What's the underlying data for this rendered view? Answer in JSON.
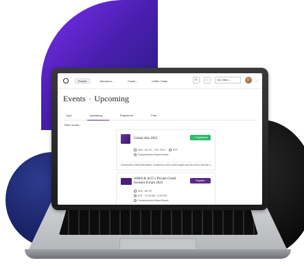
{
  "nav": {
    "items": [
      {
        "label": "Events",
        "active": true
      },
      {
        "label": "Allocators",
        "active": false
      },
      {
        "label": "Funds",
        "active": false
      },
      {
        "label": "Coffee Chats",
        "active": false
      }
    ],
    "allocators_caret": "⌄",
    "funds_caret": "⌄",
    "office_label": "My Office",
    "office_caret": "⌄",
    "avatar_caret": "⌄"
  },
  "header": {
    "crumb_1": "Events",
    "separator": "›",
    "crumb_2": "Upcoming"
  },
  "tabs": [
    {
      "label": "Type",
      "active": false
    },
    {
      "label": "Upcoming",
      "active": true
    },
    {
      "label": "Registered",
      "active": false
    },
    {
      "label": "Past",
      "active": false
    }
  ],
  "filter": {
    "label": "Filter results"
  },
  "events": [
    {
      "title": "Global Alts 2023",
      "status": "✓ Registered",
      "date": "Mon, Jan 30 – Thu, Feb 2",
      "tz": "EST",
      "location": "Fontainebleau Miami Beach",
      "description": "iConnections Global Alternatives Conference is the world's largest cap intro event. Become a..."
    },
    {
      "title": "AIMA & ACC's Private Credit Investor Forum 2023",
      "status": "Register",
      "date": "Mon, Jan 30",
      "time": "EST · 11:00 AM – 6:30 PM",
      "location": "Fontainebleau Miami Beach"
    }
  ],
  "colors": {
    "accent": "#5b2a86",
    "success": "#2fb96a"
  }
}
